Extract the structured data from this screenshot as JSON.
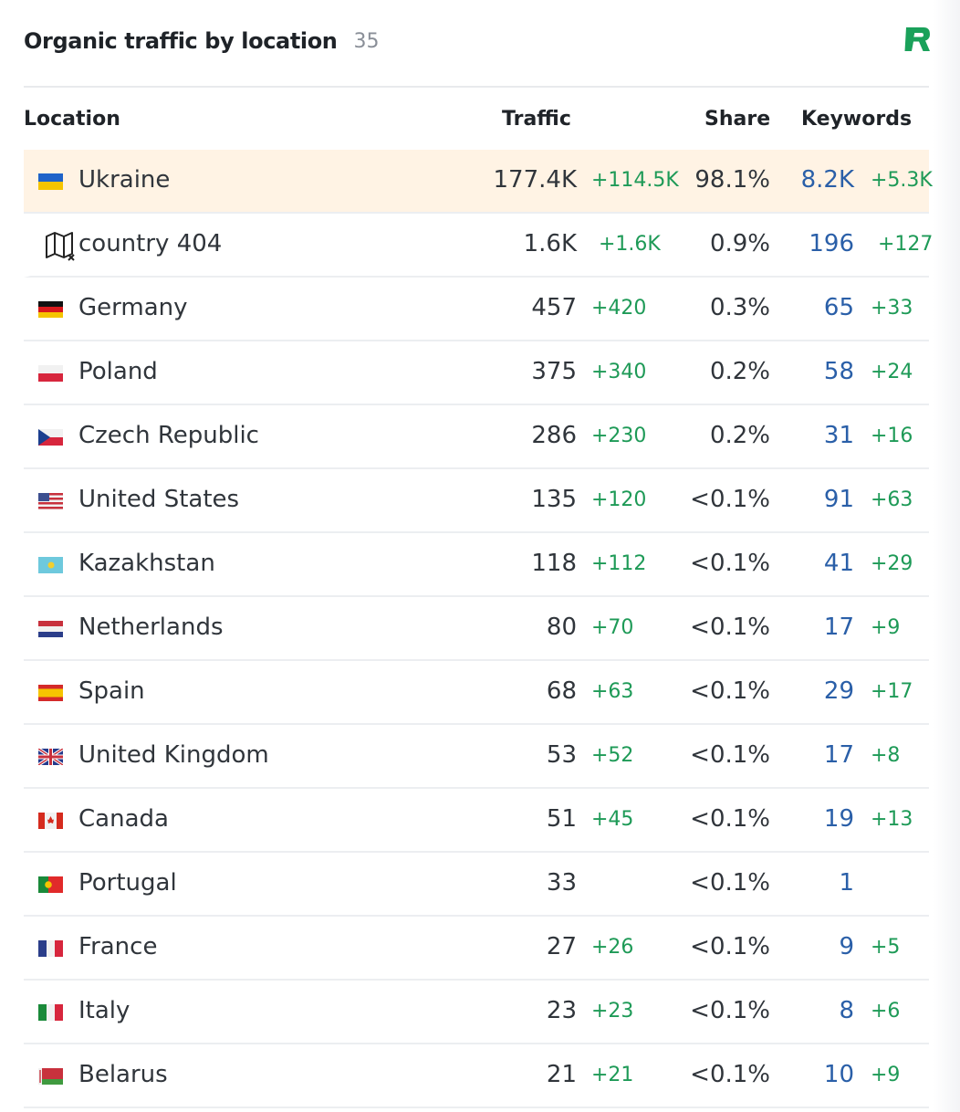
{
  "header": {
    "title": "Organic traffic by location",
    "count": "35"
  },
  "columns": {
    "location": "Location",
    "traffic": "Traffic",
    "share": "Share",
    "keywords": "Keywords"
  },
  "colors": {
    "accent_green": "#1e9a57",
    "link_blue": "#2a5fa8",
    "highlight": "#fff3e4",
    "logo_green": "#1aa15a"
  },
  "rows": [
    {
      "country": "Ukraine",
      "flag": "ua-flag-icon",
      "traffic": "177.4K",
      "traffic_delta": "+114.5K",
      "share": "98.1%",
      "keywords": "8.2K",
      "keywords_delta": "+5.3K"
    },
    {
      "country": "country 404",
      "flag": "unknown-map-icon",
      "traffic": "1.6K",
      "traffic_delta": "+1.6K",
      "share": "0.9%",
      "keywords": "196",
      "keywords_delta": "+127"
    },
    {
      "country": "Germany",
      "flag": "de-flag-icon",
      "traffic": "457",
      "traffic_delta": "+420",
      "share": "0.3%",
      "keywords": "65",
      "keywords_delta": "+33"
    },
    {
      "country": "Poland",
      "flag": "pl-flag-icon",
      "traffic": "375",
      "traffic_delta": "+340",
      "share": "0.2%",
      "keywords": "58",
      "keywords_delta": "+24"
    },
    {
      "country": "Czech Republic",
      "flag": "cz-flag-icon",
      "traffic": "286",
      "traffic_delta": "+230",
      "share": "0.2%",
      "keywords": "31",
      "keywords_delta": "+16"
    },
    {
      "country": "United States",
      "flag": "us-flag-icon",
      "traffic": "135",
      "traffic_delta": "+120",
      "share": "<0.1%",
      "keywords": "91",
      "keywords_delta": "+63"
    },
    {
      "country": "Kazakhstan",
      "flag": "kz-flag-icon",
      "traffic": "118",
      "traffic_delta": "+112",
      "share": "<0.1%",
      "keywords": "41",
      "keywords_delta": "+29"
    },
    {
      "country": "Netherlands",
      "flag": "nl-flag-icon",
      "traffic": "80",
      "traffic_delta": "+70",
      "share": "<0.1%",
      "keywords": "17",
      "keywords_delta": "+9"
    },
    {
      "country": "Spain",
      "flag": "es-flag-icon",
      "traffic": "68",
      "traffic_delta": "+63",
      "share": "<0.1%",
      "keywords": "29",
      "keywords_delta": "+17"
    },
    {
      "country": "United Kingdom",
      "flag": "gb-flag-icon",
      "traffic": "53",
      "traffic_delta": "+52",
      "share": "<0.1%",
      "keywords": "17",
      "keywords_delta": "+8"
    },
    {
      "country": "Canada",
      "flag": "ca-flag-icon",
      "traffic": "51",
      "traffic_delta": "+45",
      "share": "<0.1%",
      "keywords": "19",
      "keywords_delta": "+13"
    },
    {
      "country": "Portugal",
      "flag": "pt-flag-icon",
      "traffic": "33",
      "traffic_delta": "",
      "share": "<0.1%",
      "keywords": "1",
      "keywords_delta": ""
    },
    {
      "country": "France",
      "flag": "fr-flag-icon",
      "traffic": "27",
      "traffic_delta": "+26",
      "share": "<0.1%",
      "keywords": "9",
      "keywords_delta": "+5"
    },
    {
      "country": "Italy",
      "flag": "it-flag-icon",
      "traffic": "23",
      "traffic_delta": "+23",
      "share": "<0.1%",
      "keywords": "8",
      "keywords_delta": "+6"
    },
    {
      "country": "Belarus",
      "flag": "by-flag-icon",
      "traffic": "21",
      "traffic_delta": "+21",
      "share": "<0.1%",
      "keywords": "10",
      "keywords_delta": "+9"
    }
  ]
}
